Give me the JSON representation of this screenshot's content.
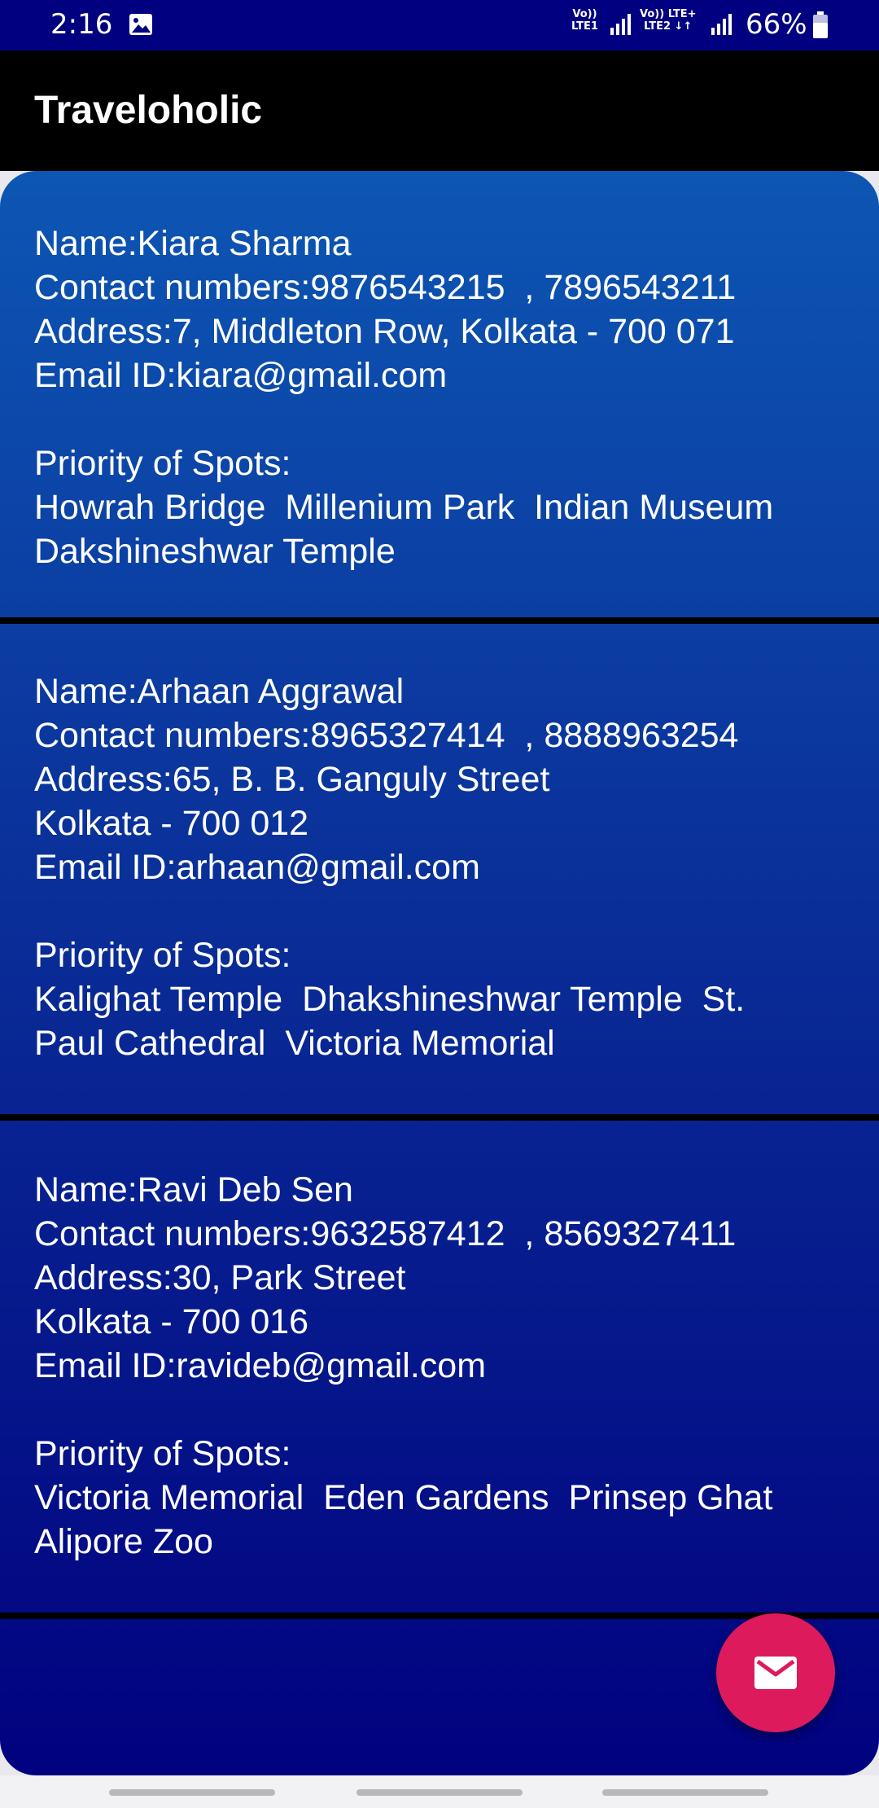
{
  "status_bar": {
    "time": "2:16",
    "sim1_label": "Vo))\nLTE1",
    "sim2_label": "Vo)) LTE+\nLTE2 ↓↑",
    "battery": "66%"
  },
  "app_bar": {
    "title": "Traveloholic"
  },
  "contacts": [
    {
      "name": "Name:Kiara Sharma",
      "contacts": "Contact numbers:9876543215  , 7896543211",
      "address_lines": [
        "Address:7, Middleton Row, Kolkata - 700 071"
      ],
      "email": "Email ID:kiara@gmail.com",
      "priority_label": "Priority of Spots:",
      "spots_lines": [
        "Howrah Bridge  Millenium Park  Indian Museum",
        "Dakshineshwar Temple"
      ]
    },
    {
      "name": "Name:Arhaan Aggrawal",
      "contacts": "Contact numbers:8965327414  , 8888963254",
      "address_lines": [
        "Address:65, B. B. Ganguly Street",
        "Kolkata - 700 012"
      ],
      "email": "Email ID:arhaan@gmail.com",
      "priority_label": "Priority of Spots:",
      "spots_lines": [
        "Kalighat Temple  Dhakshineshwar Temple  St.",
        "Paul Cathedral  Victoria Memorial"
      ]
    },
    {
      "name": "Name:Ravi Deb Sen",
      "contacts": "Contact numbers:9632587412  , 8569327411",
      "address_lines": [
        "Address:30, Park Street",
        "Kolkata - 700 016"
      ],
      "email": "Email ID:ravideb@gmail.com",
      "priority_label": "Priority of Spots:",
      "spots_lines": [
        "Victoria Memorial  Eden Gardens  Prinsep Ghat",
        "Alipore Zoo"
      ]
    }
  ],
  "fab": {
    "icon": "mail-icon"
  },
  "colors": {
    "accent": "#dc1a5c",
    "status_bar": "#000080",
    "app_bar": "#000000",
    "card_top": "#0d56b3",
    "card_bottom": "#01017f"
  }
}
